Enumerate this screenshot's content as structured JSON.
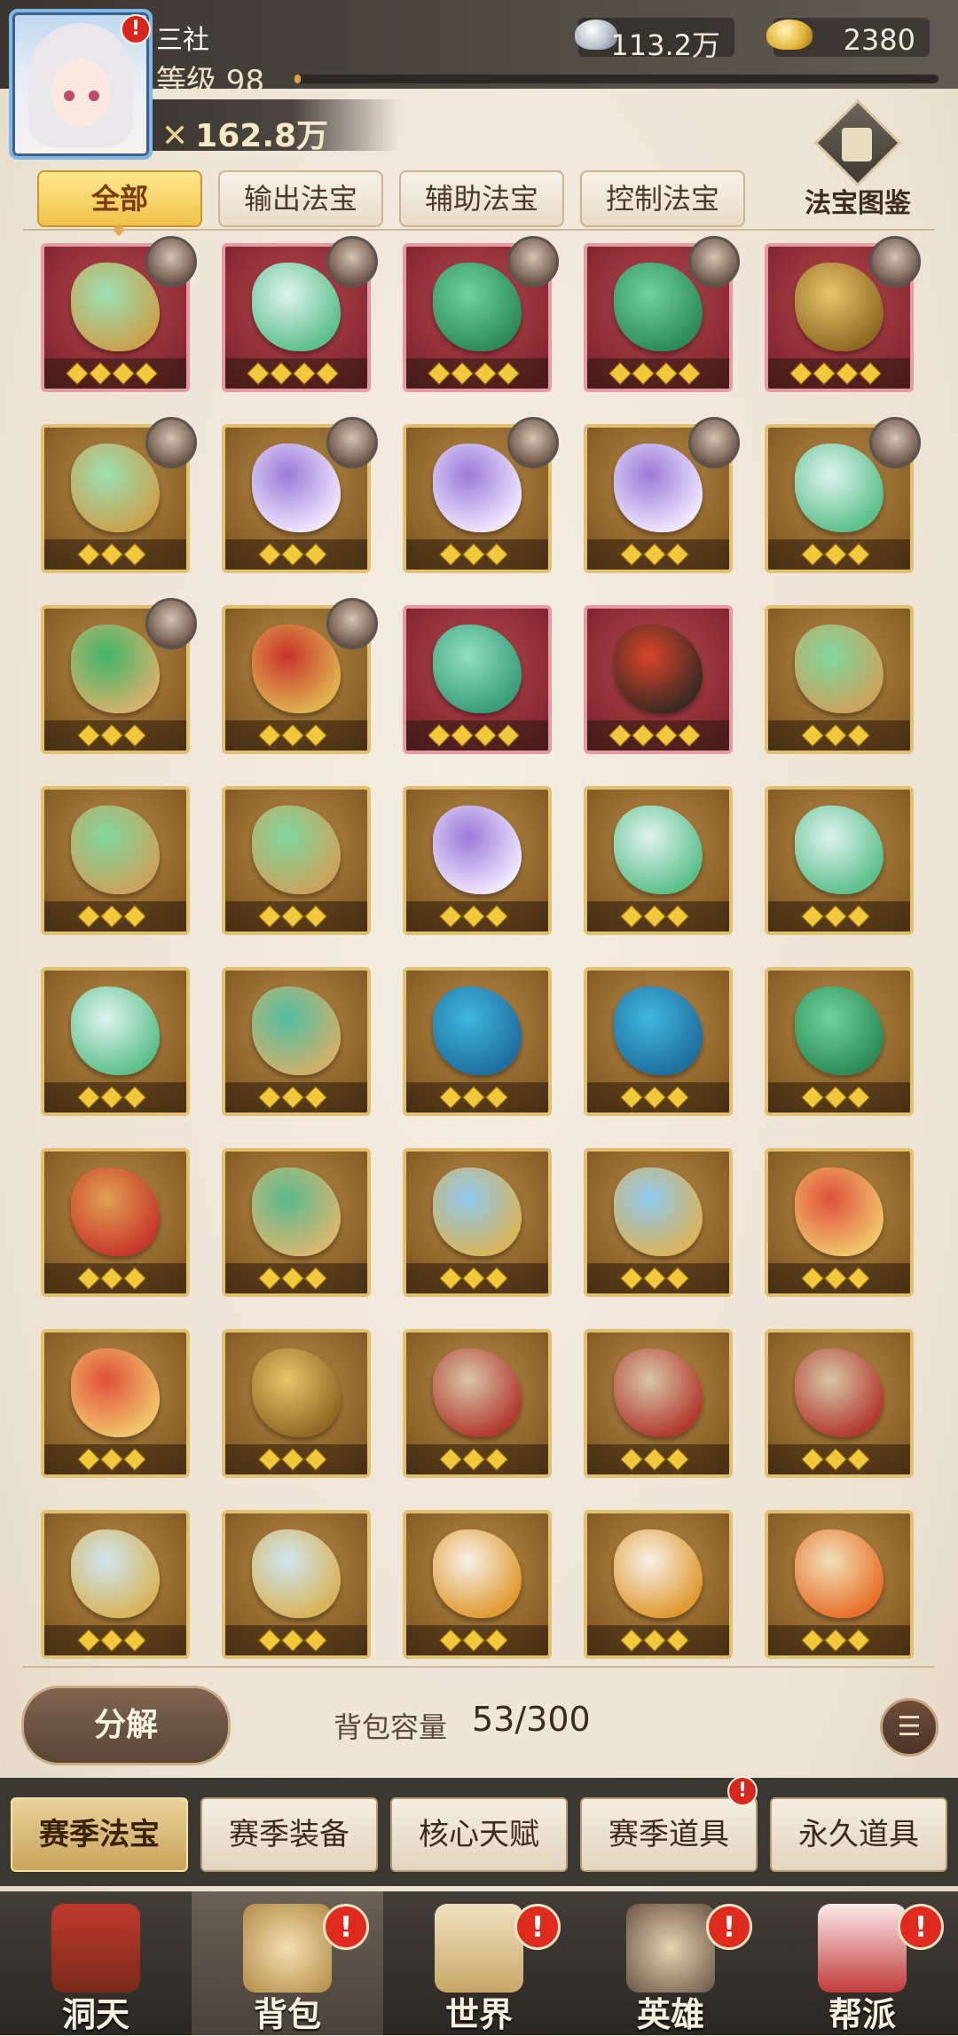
{
  "player": {
    "name": "三社",
    "level_text": "等级 98",
    "xp_progress": 0.01,
    "power": "162.8万",
    "alert": "!"
  },
  "resources": {
    "silver": "113.2万",
    "gold": "2380"
  },
  "filter_tabs": [
    {
      "label": "全部",
      "active": true
    },
    {
      "label": "输出法宝",
      "active": false
    },
    {
      "label": "辅助法宝",
      "active": false
    },
    {
      "label": "控制法宝",
      "active": false
    }
  ],
  "atlas_label": "法宝图鉴",
  "items": [
    {
      "name": "jade-scissors",
      "frame": "red",
      "stars": 4,
      "owner": true
    },
    {
      "name": "jade-vase",
      "frame": "red",
      "stars": 4,
      "owner": true
    },
    {
      "name": "jade-lotus",
      "frame": "red",
      "stars": 4,
      "owner": true
    },
    {
      "name": "jade-lotus",
      "frame": "red",
      "stars": 4,
      "owner": true
    },
    {
      "name": "gold-coin",
      "frame": "red",
      "stars": 4,
      "owner": true
    },
    {
      "name": "jade-scissors",
      "frame": "gold",
      "stars": 3,
      "owner": true
    },
    {
      "name": "purple-robe",
      "frame": "gold",
      "stars": 3,
      "owner": true
    },
    {
      "name": "purple-robe",
      "frame": "gold",
      "stars": 3,
      "owner": true
    },
    {
      "name": "purple-robe",
      "frame": "gold",
      "stars": 3,
      "owner": true
    },
    {
      "name": "jade-vase",
      "frame": "gold",
      "stars": 3,
      "owner": true
    },
    {
      "name": "crystal-orb",
      "frame": "gold",
      "stars": 3,
      "owner": true
    },
    {
      "name": "red-scepter",
      "frame": "gold",
      "stars": 3,
      "owner": true
    },
    {
      "name": "jade-sword",
      "frame": "red",
      "stars": 4,
      "owner": false
    },
    {
      "name": "fire-spear",
      "frame": "red",
      "stars": 4,
      "owner": false
    },
    {
      "name": "jade-fan",
      "frame": "gold",
      "stars": 3,
      "owner": false
    },
    {
      "name": "jade-fan",
      "frame": "gold",
      "stars": 3,
      "owner": false
    },
    {
      "name": "jade-fan",
      "frame": "gold",
      "stars": 3,
      "owner": false
    },
    {
      "name": "purple-robe",
      "frame": "gold",
      "stars": 3,
      "owner": false
    },
    {
      "name": "jade-vase",
      "frame": "gold",
      "stars": 3,
      "owner": false
    },
    {
      "name": "jade-vase",
      "frame": "gold",
      "stars": 3,
      "owner": false
    },
    {
      "name": "jade-vase",
      "frame": "gold",
      "stars": 3,
      "owner": false
    },
    {
      "name": "jade-staff",
      "frame": "gold",
      "stars": 3,
      "owner": false
    },
    {
      "name": "blue-urn",
      "frame": "gold",
      "stars": 3,
      "owner": false
    },
    {
      "name": "blue-urn",
      "frame": "gold",
      "stars": 3,
      "owner": false
    },
    {
      "name": "jade-lotus",
      "frame": "gold",
      "stars": 3,
      "owner": false
    },
    {
      "name": "red-scroll",
      "frame": "gold",
      "stars": 3,
      "owner": false
    },
    {
      "name": "jade-banner",
      "frame": "gold",
      "stars": 3,
      "owner": false
    },
    {
      "name": "blue-harp",
      "frame": "gold",
      "stars": 3,
      "owner": false
    },
    {
      "name": "blue-harp",
      "frame": "gold",
      "stars": 3,
      "owner": false
    },
    {
      "name": "red-ribbon",
      "frame": "gold",
      "stars": 3,
      "owner": false
    },
    {
      "name": "red-ribbon",
      "frame": "gold",
      "stars": 3,
      "owner": false
    },
    {
      "name": "gold-coin",
      "frame": "gold",
      "stars": 3,
      "owner": false
    },
    {
      "name": "claw-ring",
      "frame": "gold",
      "stars": 3,
      "owner": false
    },
    {
      "name": "claw-ring",
      "frame": "gold",
      "stars": 3,
      "owner": false
    },
    {
      "name": "claw-ring",
      "frame": "gold",
      "stars": 3,
      "owner": false
    },
    {
      "name": "lantern",
      "frame": "gold",
      "stars": 3,
      "owner": false
    },
    {
      "name": "lantern",
      "frame": "gold",
      "stars": 3,
      "owner": false
    },
    {
      "name": "gold-mirror",
      "frame": "gold",
      "stars": 3,
      "owner": false
    },
    {
      "name": "gold-mirror",
      "frame": "gold",
      "stars": 3,
      "owner": false
    },
    {
      "name": "fire-scroll",
      "frame": "gold",
      "stars": 3,
      "owner": false
    }
  ],
  "bottom": {
    "decompose_label": "分解",
    "capacity_label": "背包容量",
    "capacity_value": "53/300",
    "sort_icon": "filter-sort-icon"
  },
  "categories": [
    {
      "label": "赛季法宝",
      "active": true,
      "alert": false
    },
    {
      "label": "赛季装备",
      "active": false,
      "alert": false
    },
    {
      "label": "核心天赋",
      "active": false,
      "alert": false
    },
    {
      "label": "赛季道具",
      "active": false,
      "alert": true
    },
    {
      "label": "永久道具",
      "active": false,
      "alert": false
    }
  ],
  "nav": [
    {
      "label": "洞天",
      "icon": "palace-icon",
      "active": false,
      "alert": false
    },
    {
      "label": "背包",
      "icon": "bag-icon",
      "active": true,
      "alert": true
    },
    {
      "label": "世界",
      "icon": "scroll-map-icon",
      "active": false,
      "alert": true
    },
    {
      "label": "英雄",
      "icon": "hero-icon",
      "active": false,
      "alert": true
    },
    {
      "label": "帮派",
      "icon": "guild-banner-icon",
      "active": false,
      "alert": true
    }
  ],
  "colors": {
    "accent_gold": "#f0c14a",
    "alert_red": "#e12a1e",
    "frame_red": "#8a2a33",
    "frame_gold": "#8c6229"
  }
}
